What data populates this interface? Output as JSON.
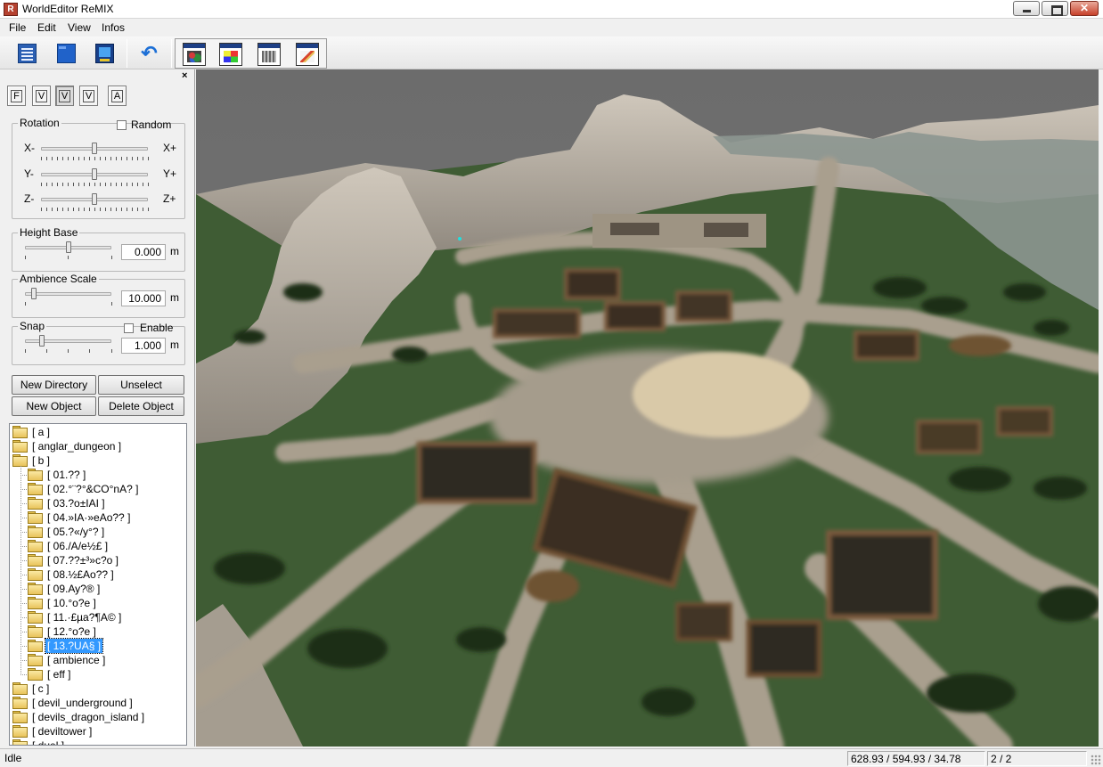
{
  "window": {
    "title": "WorldEditor ReMIX",
    "app_icon_glyph": "R"
  },
  "menu": [
    "File",
    "Edit",
    "View",
    "Infos"
  ],
  "toolbar": {
    "buttons": [
      "new-document-icon",
      "open-folder-icon",
      "save-monitor-icon",
      "undo-icon"
    ],
    "window_toggles": [
      "objects-window-icon",
      "palette-window-icon",
      "grid-window-icon",
      "paint-window-icon"
    ]
  },
  "panel": {
    "close_glyph": "×",
    "modes": [
      "F",
      "V",
      "V",
      "V",
      "A"
    ],
    "rotation": {
      "title": "Rotation",
      "random_label": "Random",
      "random_checked": false,
      "axes": [
        {
          "minus": "X-",
          "plus": "X+",
          "value": 0.5
        },
        {
          "minus": "Y-",
          "plus": "Y+",
          "value": 0.5
        },
        {
          "minus": "Z-",
          "plus": "Z+",
          "value": 0.5
        }
      ]
    },
    "height_base": {
      "title": "Height Base",
      "value": "0.000",
      "unit": "m",
      "slider": 0.5
    },
    "ambience_scale": {
      "title": "Ambience Scale",
      "value": "10.000",
      "unit": "m",
      "slider": 0.1
    },
    "snap": {
      "title": "Snap",
      "enable_label": "Enable",
      "enable_checked": false,
      "value": "1.000",
      "unit": "m",
      "slider": 0.2
    },
    "buttons": {
      "new_directory": "New Directory",
      "unselect": "Unselect",
      "new_object": "New Object",
      "delete_object": "Delete Object"
    }
  },
  "tree": [
    {
      "label": "[ a ]",
      "depth": 0
    },
    {
      "label": "[ anglar_dungeon ]",
      "depth": 0
    },
    {
      "label": "[ b ]",
      "depth": 0
    },
    {
      "label": "[ 01.?? ]",
      "depth": 1
    },
    {
      "label": "[ 02.°¨?°&CO°nA? ]",
      "depth": 1
    },
    {
      "label": "[ 03.?o±IAI ]",
      "depth": 1
    },
    {
      "label": "[ 04.»IA·»eAo?? ]",
      "depth": 1
    },
    {
      "label": "[ 05.?«/y°? ]",
      "depth": 1
    },
    {
      "label": "[ 06./A/e½£ ]",
      "depth": 1
    },
    {
      "label": "[ 07.??±³»c?o ]",
      "depth": 1
    },
    {
      "label": "[ 08.½£Ao?? ]",
      "depth": 1
    },
    {
      "label": "[ 09.Ay?® ]",
      "depth": 1
    },
    {
      "label": "[ 10.°o?e ]",
      "depth": 1
    },
    {
      "label": "[ 11.·£µa?¶A© ]",
      "depth": 1
    },
    {
      "label": "[ 12.°o?e ]",
      "depth": 1
    },
    {
      "label": "[ 13.?UA§ ]",
      "depth": 1,
      "selected": true
    },
    {
      "label": "[ ambience ]",
      "depth": 1
    },
    {
      "label": "[ eff ]",
      "depth": 1
    },
    {
      "label": "[ c ]",
      "depth": 0
    },
    {
      "label": "[ devil_underground ]",
      "depth": 0
    },
    {
      "label": "[ devils_dragon_island ]",
      "depth": 0
    },
    {
      "label": "[ deviltower ]",
      "depth": 0
    },
    {
      "label": "[ duel ]",
      "depth": 0
    }
  ],
  "status": {
    "text": "Idle",
    "coords": "628.93 / 594.93 / 34.78",
    "page": "2 / 2"
  },
  "colors": {
    "sky": "#6e6e6e",
    "grass": "#3d5a34",
    "path": "#a89f90",
    "rock": "#b8afa3",
    "water": "#8a9490"
  }
}
